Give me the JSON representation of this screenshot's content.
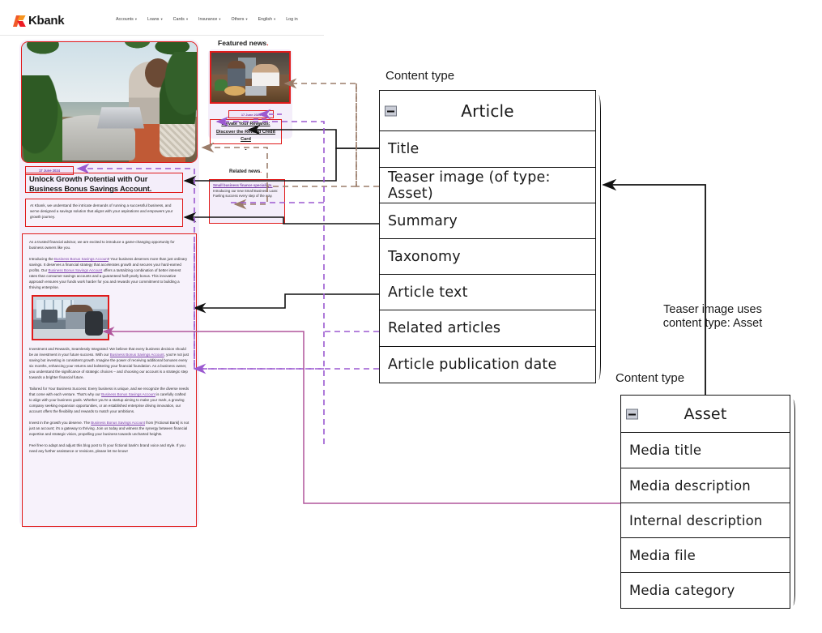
{
  "website": {
    "brand": "Kbank",
    "nav_items": [
      {
        "label": "Accounts",
        "caret": "▾"
      },
      {
        "label": "Loans",
        "caret": "▾"
      },
      {
        "label": "Cards",
        "caret": "▾"
      },
      {
        "label": "Insurance",
        "caret": "▾"
      },
      {
        "label": "Others",
        "caret": "▾"
      },
      {
        "label": "English",
        "caret": "▾"
      },
      {
        "label": "Log in",
        "caret": ""
      }
    ],
    "hero": {
      "date": "17 June 2024",
      "title": "Unlock Growth Potential with Our Business Bonus Savings Account.",
      "summary": "At Kbank, we understand the intricate demands of running a successful business, and we've designed a savings solution that aligns with your aspirations and empowers your growth journey.",
      "body": [
        "As a trusted financial advisor, we are excited to introduce a game-changing opportunity for business owners like you.",
        "Introducing the Business Bonus Savings Account! Your business deserves more than just ordinary savings. It deserves a financial strategy that accelerates growth and secures your hard-earned profits. Our Business Bonus Savings Account offers a tantalizing combination of better interest rates than consumer savings accounts and a guaranteed half-yearly bonus. This innovative approach ensures your funds work harder for you and rewards your commitment to building a thriving enterprise.",
        "Investment and Rewards, Seamlessly Integrated: We believe that every business decision should be an investment in your future success. With our Business Bonus Savings Account, you're not just saving but investing in consistent growth. Imagine the power of receiving additional bonuses every six months, enhancing your returns and bolstering your financial foundation. As a business owner, you understand the significance of strategic choices – and choosing our account is a strategic step towards a brighter financial future.",
        "Tailored for Your Business Success: Every business is unique, and we recognize the diverse needs that come with each venture. That's why our Business Bonus Savings Account is carefully crafted to align with your business goals. Whether you're a startup aiming to make your mark, a growing company seeking expansion opportunities, or an established enterprise driving innovation, our account offers the flexibility and rewards to match your ambitions.",
        "Invest in the growth you deserve. The Business Bonus Savings Account from [Fictional Bank] is not just an account; it's a gateway to thriving. Join us today and witness the synergy between financial expertise and strategic vision, propelling your business towards uncharted heights.",
        "Feel free to adapt and adjust this blog post to fit your fictional bank's brand voice and style. If you need any further assistance or revisions, please let me know!"
      ],
      "link_text": "Business Bonus Savings Account"
    },
    "featured_news": {
      "heading": "Featured news",
      "heading_dot": ".",
      "date": "17 June 2024",
      "headline": "Elevate Your Rewards: Discover the Reward Credit Card",
      "headline_dot": "."
    },
    "related_news": {
      "heading": "Related news",
      "heading_dot": ".",
      "item_title": "Small business finance specialists.",
      "item_body": "Introducing our new Small Business Loan: Fueling success every step of the way."
    }
  },
  "diagram": {
    "article_label": "Content type",
    "asset_label": "Content type",
    "teaser_note": "Teaser image uses content type: Asset",
    "article": {
      "name": "Article",
      "fields": [
        "Title",
        "Teaser image (of type: Asset)",
        "Summary",
        "Taxonomy",
        "Article text",
        "Related articles",
        "Article publication date"
      ]
    },
    "asset": {
      "name": "Asset",
      "fields": [
        "Media title",
        "Media description",
        "Internal description",
        "Media file",
        "Media category"
      ]
    },
    "colors": {
      "highlight_red": "#e01b1b",
      "purple": "#9b59d0",
      "brown": "#9b7d6a",
      "magenta": "#b0559b",
      "brand_orange": "#f15a29"
    }
  }
}
